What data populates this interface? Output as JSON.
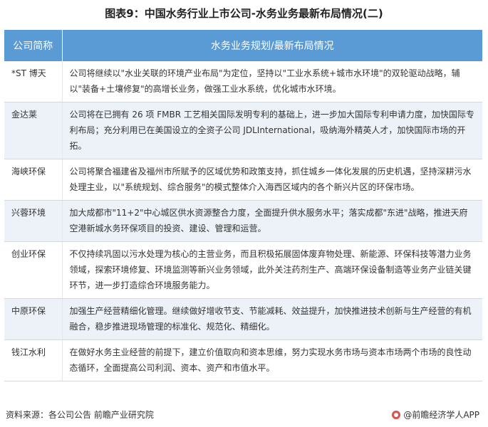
{
  "title": "图表9：中国水务行业上市公司-水务业务最新布局情况(二)",
  "table": {
    "headers": [
      "公司简称",
      "水务业务规划/最新布局情况"
    ],
    "rows": [
      {
        "name": "*ST 博天",
        "desc": "公司将继续以\"水业关联的环境产业布局\"为定位，坚持以\"工业水系统+城市水环境\"的双轮驱动战略，辅以\"装备+土壤修复\"的高增长业务，做强工业水系统，优化城市水环境。"
      },
      {
        "name": "金达莱",
        "desc": "公司将在已拥有 26 项 FMBR 工艺相关国际发明专利的基础上，进一步加大国际专利申请力度，加快国际专利布局；充分利用已在美国设立的全资子公司 JDLInternational，吸纳海外精英人才，加快国际市场的开拓。"
      },
      {
        "name": "海峡环保",
        "desc": "公司将聚合福建省及福州市所赋予的区域优势和政策支持，抓住城乡一体化发展的历史机遇，坚持深耕污水处理主业，以\"系统规划、综合服务\"的模式整体介入海西区域内的各个新兴片区的环保市场。"
      },
      {
        "name": "兴蓉环境",
        "desc": "加大成都市\"11+2\"中心城区供水资源整合力度，全面提升供水服务水平；落实成都\"东进\"战略，推进天府空港新城水务环保项目的投资、建设、管理和运营。"
      },
      {
        "name": "创业环保",
        "desc": "不仅持续巩固以污水处理为核心的主营业务，而且积极拓展固体废弃物处理、新能源、环保科技等潜力业务领域，探索环境修复、环境监测等新兴业务领域，此外关注药剂生产、高端环保设备制造等业务产业链关键环节，进一步打造综合环境服务能力。"
      },
      {
        "name": "中原环保",
        "desc": "加强生产经营精细化管理。继续做好增收节支、节能减耗、效益提升，加快推进技术创新与生产经营的有机融合，稳步推进现场管理的标准化、规范化、精细化。"
      },
      {
        "name": "钱江水利",
        "desc": "在做好水务主业经营的前提下，建立价值取向和资本思维，努力实现水务市场与资本市场两个市场的良性动态循环，全面提高公司利润、资本、资产和市值水平。"
      }
    ]
  },
  "footer": {
    "source": "资料来源：各公司公告 前瞻产业研究院",
    "brand": "@前瞻经济学人APP",
    "brand_icon": "qianzhan-logo-icon"
  }
}
